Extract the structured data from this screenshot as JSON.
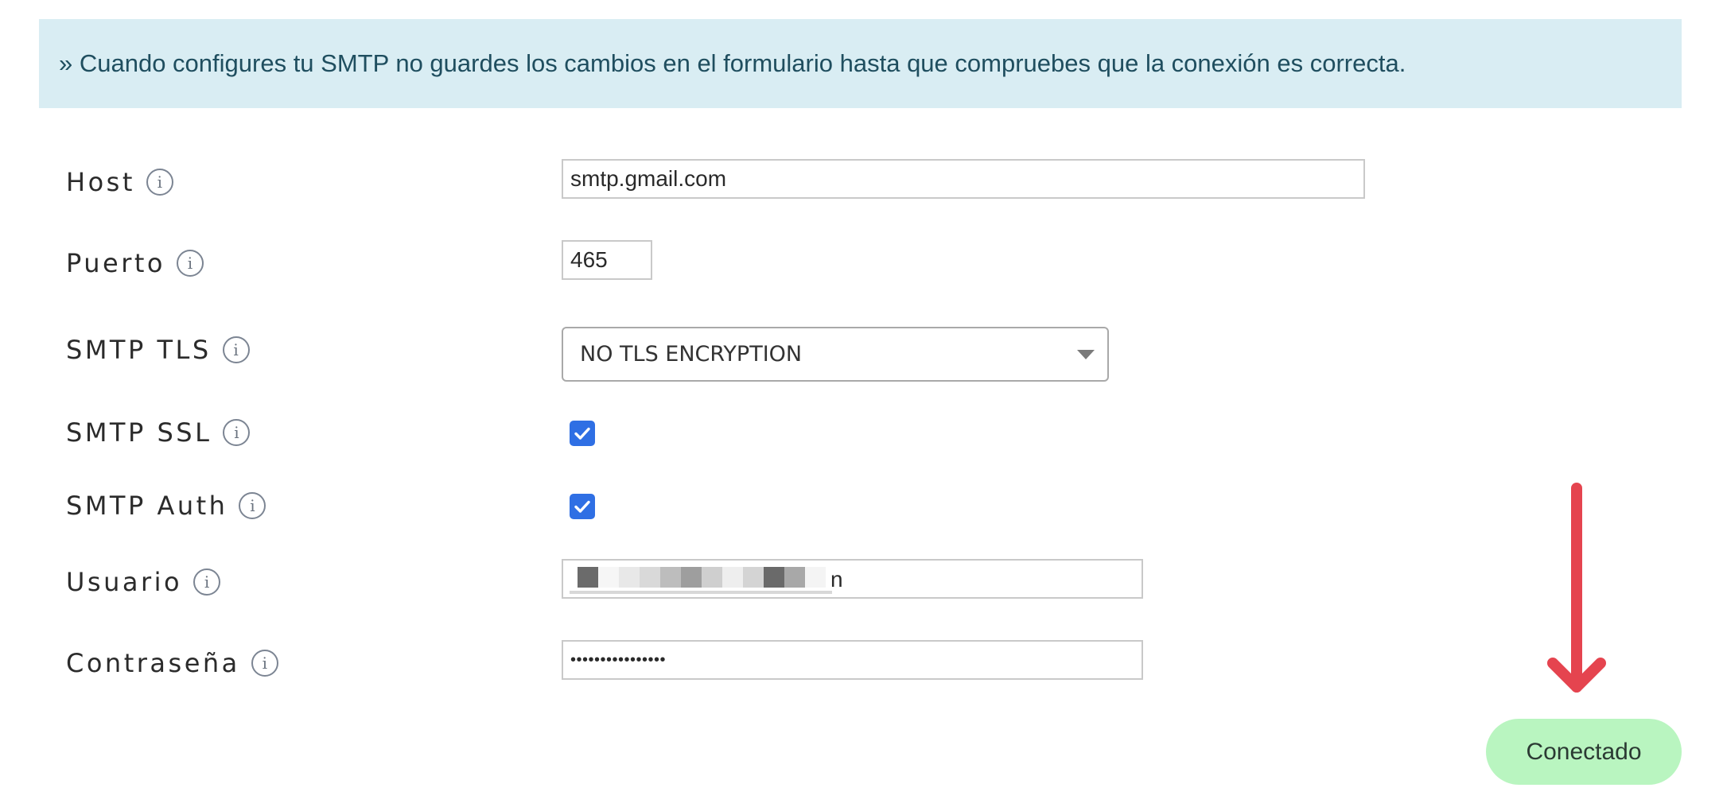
{
  "notice": {
    "text": "» Cuando configures tu SMTP no guardes los cambios en el formulario hasta que compruebes que la conexión es correcta."
  },
  "form": {
    "host": {
      "label": "Host",
      "value": "smtp.gmail.com"
    },
    "puerto": {
      "label": "Puerto",
      "value": "465"
    },
    "smtp_tls": {
      "label": "SMTP TLS",
      "selected": "NO TLS ENCRYPTION"
    },
    "smtp_ssl": {
      "label": "SMTP SSL",
      "checked": true
    },
    "smtp_auth": {
      "label": "SMTP Auth",
      "checked": true
    },
    "usuario": {
      "label": "Usuario",
      "visible_tail": "n"
    },
    "contrasena": {
      "label": "Contraseña",
      "masked_value": "••••••••••••••••"
    },
    "info_icon_glyph": "i"
  },
  "actions": {
    "connect_label": "Conectado"
  },
  "colors": {
    "notice_background": "#d9edf3",
    "notice_text": "#1f4e5f",
    "checkbox_checked": "#2f6fe4",
    "connect_button": "#b9f5c0",
    "annotation_arrow": "#e5444f"
  },
  "icons": {
    "info": "info-circle-icon",
    "check": "check-icon",
    "dropdown": "chevron-down-icon",
    "annotation": "arrow-down-icon"
  }
}
